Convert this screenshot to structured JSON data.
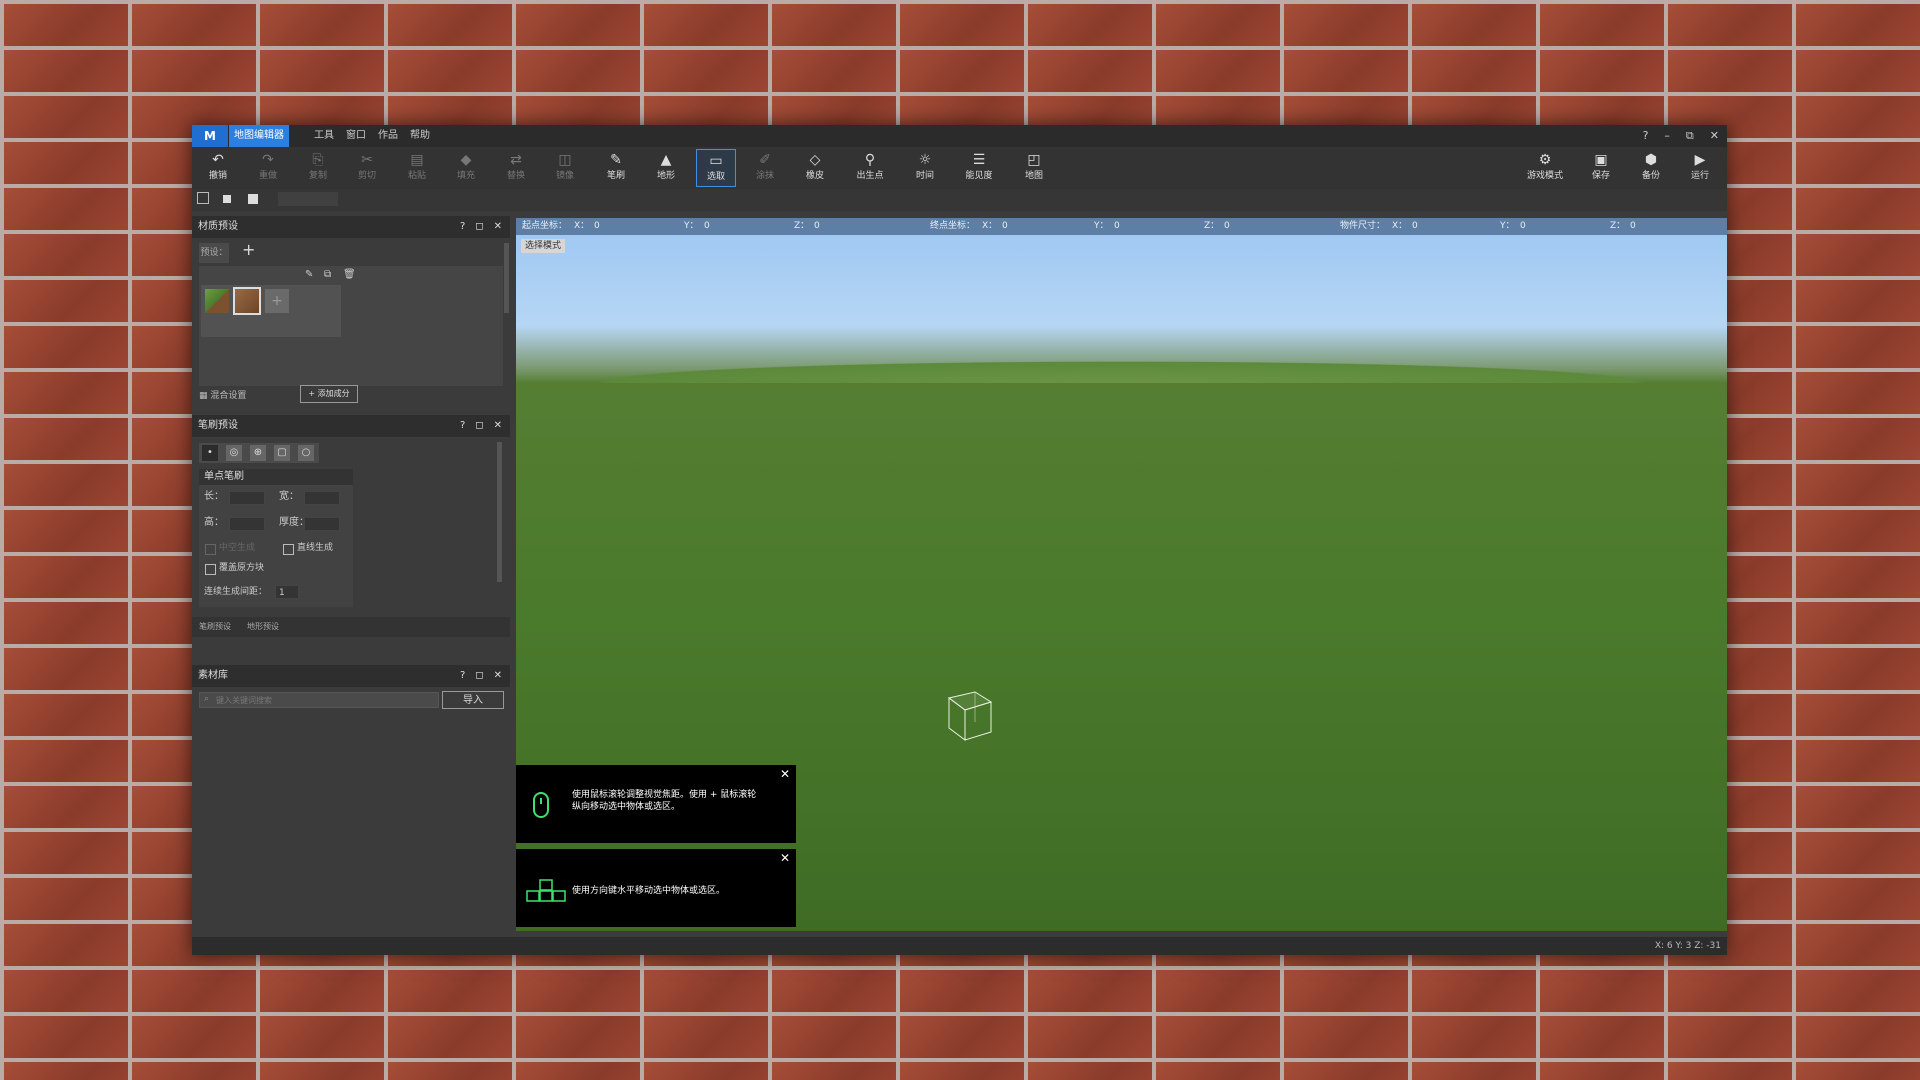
{
  "titlebar": {
    "logo": "M",
    "app_title": "地图编辑器",
    "menu": [
      "工具",
      "窗口",
      "作品",
      "帮助"
    ],
    "controls": [
      "?",
      "–",
      "⧉",
      "✕"
    ]
  },
  "toolbar": {
    "left": [
      {
        "label": "撤销",
        "icon": "↶"
      },
      {
        "label": "重做",
        "icon": "↷"
      },
      {
        "label": "复制",
        "icon": "⎘"
      },
      {
        "label": "剪切",
        "icon": "✂"
      },
      {
        "label": "粘贴",
        "icon": "▤"
      },
      {
        "label": "填充",
        "icon": "◆"
      },
      {
        "label": "替换",
        "icon": "⇄"
      },
      {
        "label": "镜像",
        "icon": "◫"
      },
      {
        "label": "笔刷",
        "icon": "✎"
      },
      {
        "label": "地形",
        "icon": "▲"
      },
      {
        "label": "选取",
        "icon": "▭"
      },
      {
        "label": "涂抹",
        "icon": "✐"
      },
      {
        "label": "橡皮",
        "icon": "◇"
      },
      {
        "label": "出生点",
        "icon": "⚲"
      },
      {
        "label": "时间",
        "icon": "☼"
      },
      {
        "label": "能见度",
        "icon": "☰"
      },
      {
        "label": "地图",
        "icon": "◰"
      }
    ],
    "right": [
      {
        "label": "游戏模式",
        "icon": "⚙"
      },
      {
        "label": "保存",
        "icon": "▣"
      },
      {
        "label": "备份",
        "icon": "⬢"
      },
      {
        "label": "运行",
        "icon": "▶"
      }
    ]
  },
  "panels": {
    "material": {
      "title": "材质预设",
      "preset_label": "预设：",
      "add": "+",
      "global_settings": "混合设置",
      "add_component": "+ 添加成分"
    },
    "brush": {
      "title": "笔刷预设",
      "section": "单点笔刷",
      "length_label": "长：",
      "width_label": "宽：",
      "height_label": "高：",
      "thickness_label": "厚度：",
      "hollow_label": "中空生成",
      "line_label": "直线生成",
      "cover_label": "覆盖原方块",
      "interval_label": "连续生成间距：",
      "interval_value": "1",
      "tab_brush": "笔刷预设",
      "tab_terrain": "地形预设"
    },
    "assets": {
      "title": "素材库",
      "search_placeholder": "键入关键词搜索",
      "import": "导入"
    }
  },
  "viewport": {
    "coords": {
      "start": "起点坐标：",
      "end": "终点坐标：",
      "size": "物件尺寸：",
      "x": "X：",
      "y": "Y：",
      "z": "Z：",
      "zero": "0"
    },
    "mode": "选择模式"
  },
  "hints": [
    {
      "text": "使用鼠标滚轮调整视觉焦距。使用 + 鼠标滚轮纵向移动选中物体或选区。"
    },
    {
      "text": "使用方向键水平移动选中物体或选区。"
    }
  ],
  "status": "X: 6  Y: 3  Z: -31"
}
